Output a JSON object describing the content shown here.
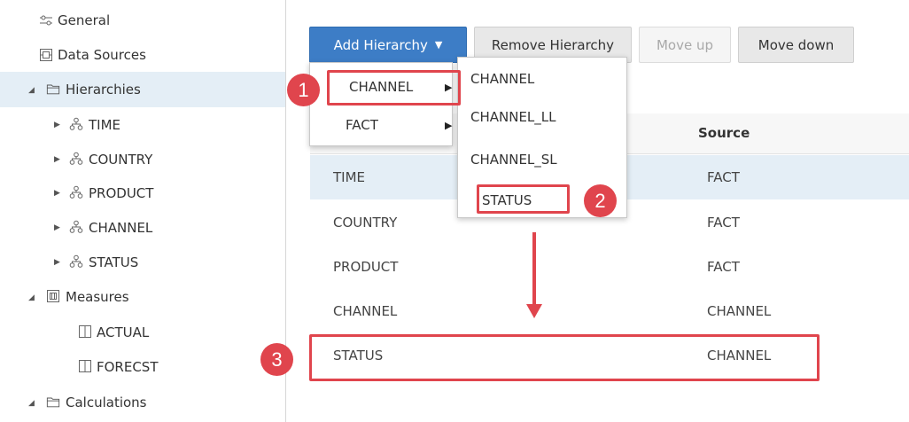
{
  "sidebar": {
    "items": [
      {
        "label": "General",
        "icon": "sliders-icon"
      },
      {
        "label": "Data Sources",
        "icon": "data-source-icon"
      },
      {
        "label": "Hierarchies",
        "icon": "folder-icon",
        "expanded": true,
        "selected": true
      },
      {
        "label": "TIME",
        "icon": "hierarchy-icon"
      },
      {
        "label": "COUNTRY",
        "icon": "hierarchy-icon"
      },
      {
        "label": "PRODUCT",
        "icon": "hierarchy-icon"
      },
      {
        "label": "CHANNEL",
        "icon": "hierarchy-icon"
      },
      {
        "label": "STATUS",
        "icon": "hierarchy-icon"
      },
      {
        "label": "Measures",
        "icon": "measures-icon",
        "expanded": true
      },
      {
        "label": "ACTUAL",
        "icon": "column-icon"
      },
      {
        "label": "FORECST",
        "icon": "column-icon"
      },
      {
        "label": "Calculations",
        "icon": "folder-icon",
        "expanded": true
      }
    ]
  },
  "toolbar": {
    "add_label": "Add Hierarchy",
    "remove_label": "Remove Hierarchy",
    "move_up_label": "Move up",
    "move_down_label": "Move down"
  },
  "menus": {
    "add_menu": [
      {
        "label": "CHANNEL"
      },
      {
        "label": "FACT"
      }
    ],
    "channel_submenu": [
      {
        "label": "CHANNEL"
      },
      {
        "label": "CHANNEL_LL"
      },
      {
        "label": "CHANNEL_SL"
      },
      {
        "label": "STATUS"
      }
    ]
  },
  "table": {
    "columns": [
      "",
      "Source"
    ],
    "rows": [
      {
        "hierarchy": "TIME",
        "source": "FACT"
      },
      {
        "hierarchy": "COUNTRY",
        "source": "FACT"
      },
      {
        "hierarchy": "PRODUCT",
        "source": "FACT"
      },
      {
        "hierarchy": "CHANNEL",
        "source": "CHANNEL"
      },
      {
        "hierarchy": "STATUS",
        "source": "CHANNEL"
      }
    ]
  },
  "callouts": [
    "1",
    "2",
    "3"
  ],
  "colors": {
    "accent": "#3d7dc6",
    "highlight": "#e0454d",
    "selected_row": "#e4eef6"
  }
}
